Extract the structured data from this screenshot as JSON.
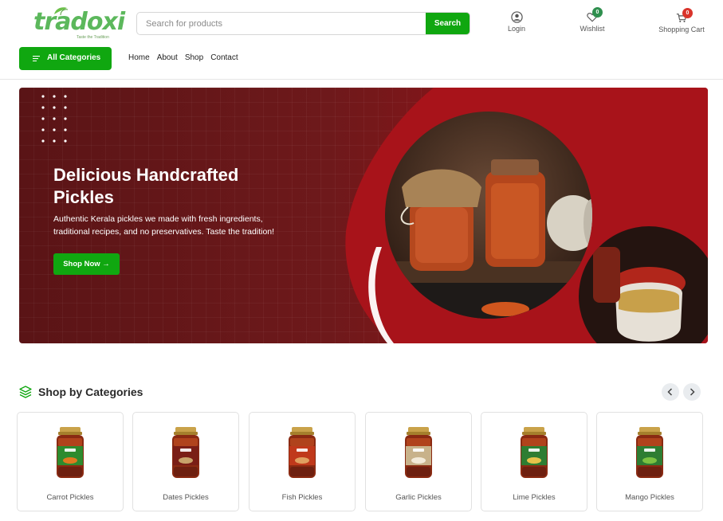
{
  "brand": {
    "name": "tradoxi",
    "tagline": "Taste the Tradition"
  },
  "search": {
    "placeholder": "Search for products",
    "button_label": "Search"
  },
  "header_actions": {
    "login_label": "Login",
    "wishlist_label": "Wishlist",
    "wishlist_count": "0",
    "cart_label": "Shopping Cart",
    "cart_count": "0"
  },
  "categories_button": {
    "label": "All Categories"
  },
  "nav": {
    "items": [
      {
        "label": "Home"
      },
      {
        "label": "About"
      },
      {
        "label": "Shop"
      },
      {
        "label": "Contact"
      }
    ]
  },
  "hero": {
    "title": "Delicious Handcrafted Pickles",
    "description": "Authentic Kerala pickles we made with fresh ingredients, traditional recipes, and no preservatives. Taste the tradition!",
    "cta_label": "Shop Now →"
  },
  "categories_section": {
    "title": "Shop by Categories",
    "items": [
      {
        "name": "Carrot Pickles",
        "label_color": "#2e8b2e",
        "accent": "#e07a1f"
      },
      {
        "name": "Dates Pickles",
        "label_color": "#7a1e16",
        "accent": "#c8a36a"
      },
      {
        "name": "Fish Pickles",
        "label_color": "#c0391b",
        "accent": "#e0a060"
      },
      {
        "name": "Garlic Pickles",
        "label_color": "#c8b28a",
        "accent": "#f2ead8"
      },
      {
        "name": "Lime Pickles",
        "label_color": "#2e7d32",
        "accent": "#e6c34a"
      },
      {
        "name": "Mango Pickles",
        "label_color": "#2e7d32",
        "accent": "#7cc242"
      }
    ]
  },
  "colors": {
    "primary_green": "#10a710",
    "hero_red": "#6e191b",
    "badge_green": "#2f8f4e",
    "badge_red": "#d9342b"
  }
}
